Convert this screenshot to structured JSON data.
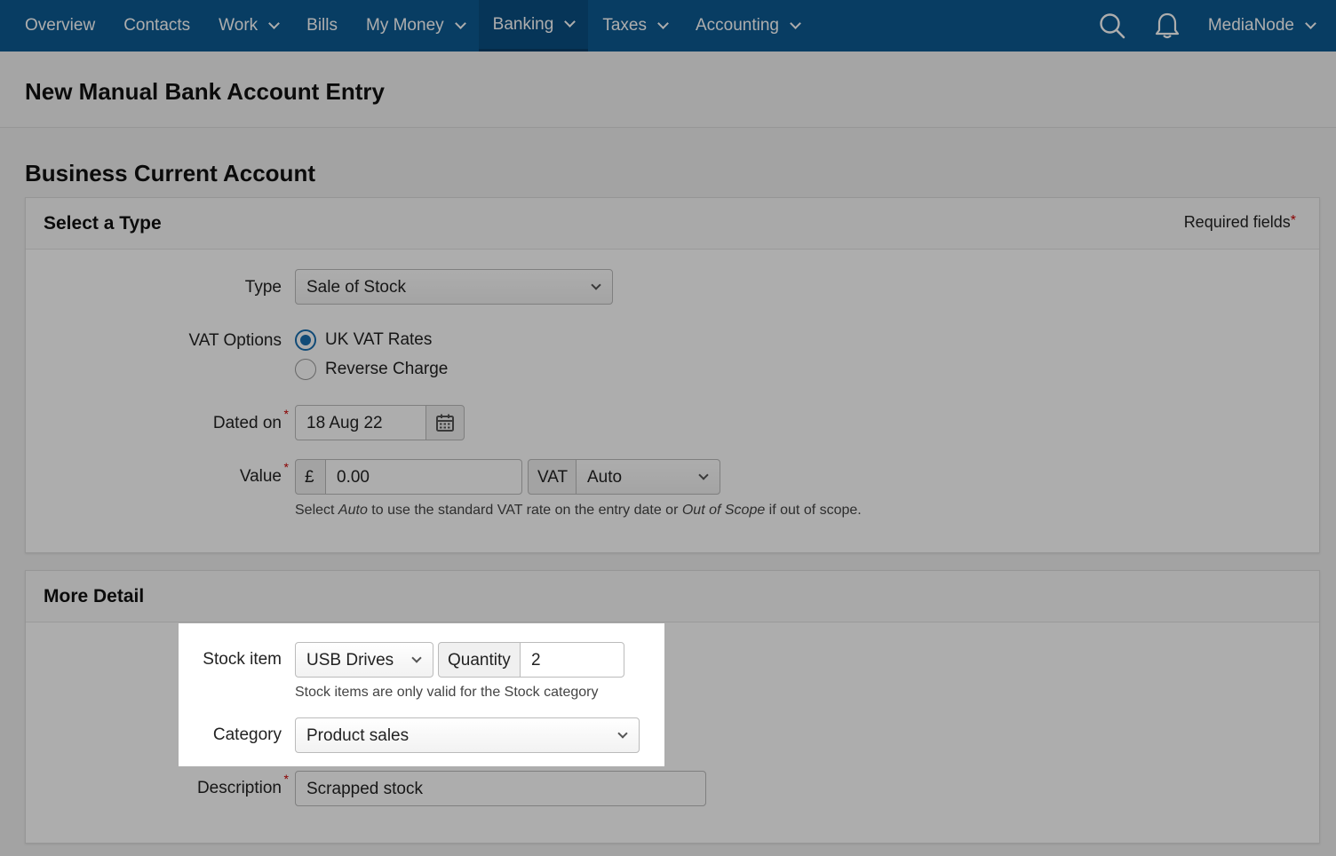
{
  "nav": {
    "items": [
      {
        "label": "Overview",
        "dropdown": false
      },
      {
        "label": "Contacts",
        "dropdown": false
      },
      {
        "label": "Work",
        "dropdown": true
      },
      {
        "label": "Bills",
        "dropdown": false
      },
      {
        "label": "My Money",
        "dropdown": true
      },
      {
        "label": "Banking",
        "dropdown": true,
        "active": true
      },
      {
        "label": "Taxes",
        "dropdown": true
      },
      {
        "label": "Accounting",
        "dropdown": true
      }
    ],
    "user": "MediaNode",
    "icons": [
      "search-icon",
      "bell-icon"
    ]
  },
  "page": {
    "title": "New Manual Bank Account Entry",
    "account": "Business Current Account"
  },
  "type_panel": {
    "title": "Select a Type",
    "required_note": "Required fields",
    "type_label": "Type",
    "type_value": "Sale of Stock",
    "vat_label": "VAT Options",
    "vat_options": [
      "UK VAT Rates",
      "Reverse Charge"
    ],
    "vat_selected": "UK VAT Rates",
    "dated_label": "Dated on",
    "dated_value": "18 Aug 22",
    "value_label": "Value",
    "currency": "£",
    "amount": "0.00",
    "vat_addon": "VAT",
    "vat_value": "Auto",
    "hint_pre": "Select ",
    "hint_auto": "Auto",
    "hint_mid": " to use the standard VAT rate on the entry date or ",
    "hint_oos": "Out of Scope",
    "hint_post": " if out of scope."
  },
  "detail_panel": {
    "title": "More Detail",
    "stock_label": "Stock item",
    "stock_value": "USB Drives",
    "quantity_label": "Quantity",
    "quantity_value": "2",
    "stock_hint": "Stock items are only valid for the Stock category",
    "category_label": "Category",
    "category_value": "Product sales",
    "description_label": "Description",
    "description_value": "Scrapped stock"
  },
  "colors": {
    "nav": "#0c5b93",
    "accent": "#1a6fb0",
    "required": "#cc0000"
  }
}
